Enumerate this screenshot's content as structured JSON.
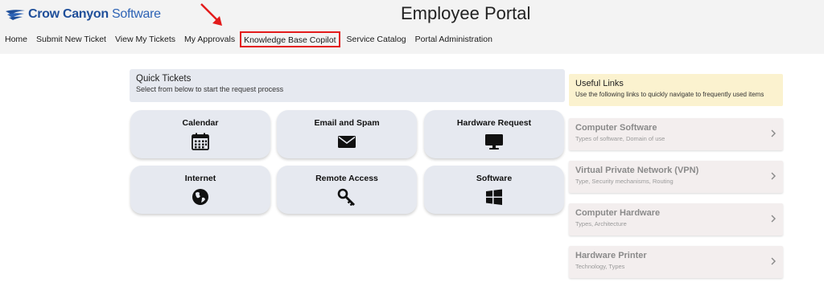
{
  "header": {
    "logo_brand": "Crow Canyon",
    "logo_suffix": "Software",
    "title": "Employee Portal"
  },
  "nav": {
    "items": [
      {
        "label": "Home"
      },
      {
        "label": "Submit New Ticket"
      },
      {
        "label": "View My Tickets"
      },
      {
        "label": "My Approvals"
      },
      {
        "label": "Knowledge Base Copilot"
      },
      {
        "label": "Service Catalog"
      },
      {
        "label": "Portal Administration"
      }
    ]
  },
  "annotation": {
    "arrow_color": "#e31b1b",
    "highlight_color": "#e31b1b",
    "highlighted_item": "Knowledge Base Copilot"
  },
  "quick_tickets": {
    "title": "Quick Tickets",
    "subtitle": "Select from below to start the request process",
    "tiles": [
      {
        "label": "Calendar",
        "icon": "calendar-icon"
      },
      {
        "label": "Email and Spam",
        "icon": "envelope-icon"
      },
      {
        "label": "Hardware Request",
        "icon": "monitor-icon"
      },
      {
        "label": "Internet",
        "icon": "globe-icon"
      },
      {
        "label": "Remote Access",
        "icon": "key-icon"
      },
      {
        "label": "Software",
        "icon": "windows-icon"
      }
    ]
  },
  "useful_links": {
    "title": "Useful Links",
    "subtitle": "Use the following links to quickly navigate to frequently used items",
    "items": [
      {
        "title": "Computer Software",
        "subtitle": "Types of software, Domain of use"
      },
      {
        "title": "Virtual Private Network (VPN)",
        "subtitle": "Type, Security mechanisms, Routing"
      },
      {
        "title": "Computer Hardware",
        "subtitle": "Types, Architecture"
      },
      {
        "title": "Hardware Printer",
        "subtitle": "Technology, Types"
      }
    ]
  },
  "colors": {
    "brand": "#1f4f9a",
    "tile_bg": "#e6e9f0",
    "useful_links_bg": "#fbf2cf",
    "link_bg": "#f3eeee"
  }
}
